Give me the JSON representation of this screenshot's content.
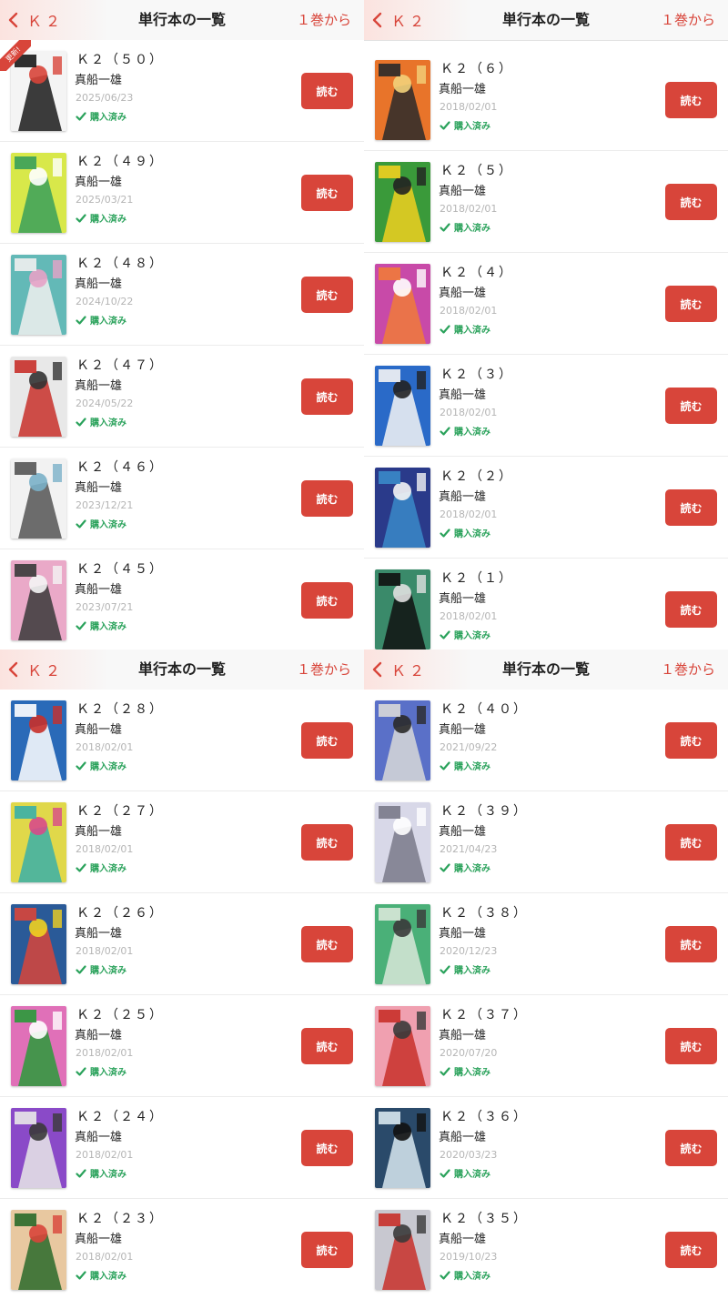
{
  "header": {
    "back_label": "Ｋ２",
    "title": "単行本の一覧",
    "right_label": "１巻から"
  },
  "accent_color": "#d8453a",
  "purchased_color": "#2aa25b",
  "panels": {
    "top_left": {
      "items": [
        {
          "title": "Ｋ２（５０）",
          "author": "真船一雄",
          "date": "2025/06/23",
          "status": "購入済み",
          "button": "読む",
          "badge": "更新!"
        },
        {
          "title": "Ｋ２（４９）",
          "author": "真船一雄",
          "date": "2025/03/21",
          "status": "購入済み",
          "button": "読む"
        },
        {
          "title": "Ｋ２（４８）",
          "author": "真船一雄",
          "date": "2024/10/22",
          "status": "購入済み",
          "button": "読む"
        },
        {
          "title": "Ｋ２（４７）",
          "author": "真船一雄",
          "date": "2024/05/22",
          "status": "購入済み",
          "button": "読む"
        },
        {
          "title": "Ｋ２（４６）",
          "author": "真船一雄",
          "date": "2023/12/21",
          "status": "購入済み",
          "button": "読む"
        },
        {
          "title": "Ｋ２（４５）",
          "author": "真船一雄",
          "date": "2023/07/21",
          "status": "購入済み",
          "button": "読む"
        }
      ]
    },
    "top_right": {
      "items": [
        {
          "title": "Ｋ２（６）",
          "author": "真船一雄",
          "date": "2018/02/01",
          "status": "購入済み",
          "button": "読む"
        },
        {
          "title": "Ｋ２（５）",
          "author": "真船一雄",
          "date": "2018/02/01",
          "status": "購入済み",
          "button": "読む"
        },
        {
          "title": "Ｋ２（４）",
          "author": "真船一雄",
          "date": "2018/02/01",
          "status": "購入済み",
          "button": "読む"
        },
        {
          "title": "Ｋ２（３）",
          "author": "真船一雄",
          "date": "2018/02/01",
          "status": "購入済み",
          "button": "読む"
        },
        {
          "title": "Ｋ２（２）",
          "author": "真船一雄",
          "date": "2018/02/01",
          "status": "購入済み",
          "button": "読む"
        },
        {
          "title": "Ｋ２（１）",
          "author": "真船一雄",
          "date": "2018/02/01",
          "status": "購入済み",
          "button": "読む"
        }
      ]
    },
    "bottom_left": {
      "items": [
        {
          "title": "Ｋ２（２８）",
          "author": "真船一雄",
          "date": "2018/02/01",
          "status": "購入済み",
          "button": "読む"
        },
        {
          "title": "Ｋ２（２７）",
          "author": "真船一雄",
          "date": "2018/02/01",
          "status": "購入済み",
          "button": "読む"
        },
        {
          "title": "Ｋ２（２６）",
          "author": "真船一雄",
          "date": "2018/02/01",
          "status": "購入済み",
          "button": "読む"
        },
        {
          "title": "Ｋ２（２５）",
          "author": "真船一雄",
          "date": "2018/02/01",
          "status": "購入済み",
          "button": "読む"
        },
        {
          "title": "Ｋ２（２４）",
          "author": "真船一雄",
          "date": "2018/02/01",
          "status": "購入済み",
          "button": "読む"
        },
        {
          "title": "Ｋ２（２３）",
          "author": "真船一雄",
          "date": "2018/02/01",
          "status": "購入済み",
          "button": "読む"
        }
      ]
    },
    "bottom_right": {
      "items": [
        {
          "title": "Ｋ２（４０）",
          "author": "真船一雄",
          "date": "2021/09/22",
          "status": "購入済み",
          "button": "読む"
        },
        {
          "title": "Ｋ２（３９）",
          "author": "真船一雄",
          "date": "2021/04/23",
          "status": "購入済み",
          "button": "読む"
        },
        {
          "title": "Ｋ２（３８）",
          "author": "真船一雄",
          "date": "2020/12/23",
          "status": "購入済み",
          "button": "読む"
        },
        {
          "title": "Ｋ２（３７）",
          "author": "真船一雄",
          "date": "2020/07/20",
          "status": "購入済み",
          "button": "読む"
        },
        {
          "title": "Ｋ２（３６）",
          "author": "真船一雄",
          "date": "2020/03/23",
          "status": "購入済み",
          "button": "読む"
        },
        {
          "title": "Ｋ２（３５）",
          "author": "真船一雄",
          "date": "2019/10/23",
          "status": "購入済み",
          "button": "読む"
        }
      ]
    }
  }
}
